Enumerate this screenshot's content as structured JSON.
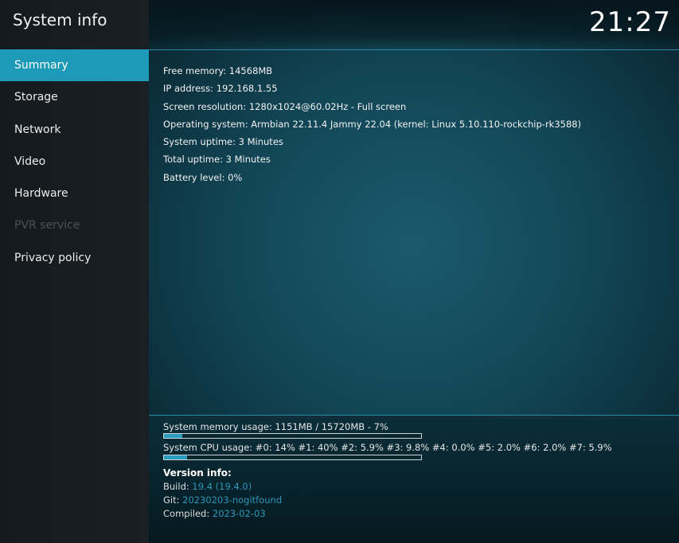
{
  "app": {
    "title": "System info",
    "clock": "21:27"
  },
  "sidebar": {
    "items": [
      {
        "label": "Summary",
        "state": "active"
      },
      {
        "label": "Storage",
        "state": "normal"
      },
      {
        "label": "Network",
        "state": "normal"
      },
      {
        "label": "Video",
        "state": "normal"
      },
      {
        "label": "Hardware",
        "state": "normal"
      },
      {
        "label": "PVR service",
        "state": "disabled"
      },
      {
        "label": "Privacy policy",
        "state": "normal"
      }
    ]
  },
  "summary": {
    "lines": [
      "Free memory: 14568MB",
      "IP address: 192.168.1.55",
      "Screen resolution: 1280x1024@60.02Hz - Full screen",
      "Operating system: Armbian 22.11.4 Jammy 22.04 (kernel: Linux 5.10.110-rockchip-rk3588)",
      "System uptime: 3 Minutes",
      "Total uptime: 3 Minutes",
      "Battery level: 0%"
    ]
  },
  "usage": {
    "memory": {
      "label": "System memory usage: 1151MB / 15720MB - 7%",
      "percent": 7
    },
    "cpu": {
      "label": "System CPU usage: #0:  14% #1:  40% #2: 5.9% #3: 9.8% #4: 0.0% #5: 2.0% #6: 2.0% #7: 5.9%",
      "percent": 9
    }
  },
  "version": {
    "heading": "Version info:",
    "build_label": "Build:",
    "build_value": "19.4 (19.4.0)",
    "git_label": "Git:",
    "git_value": "20230203-nogitfound",
    "compiled_label": "Compiled:",
    "compiled_value": "2023-02-03"
  },
  "colors": {
    "accent": "#1c9ab8",
    "value_text": "#2d97b7",
    "disabled_text": "#4b5257"
  }
}
